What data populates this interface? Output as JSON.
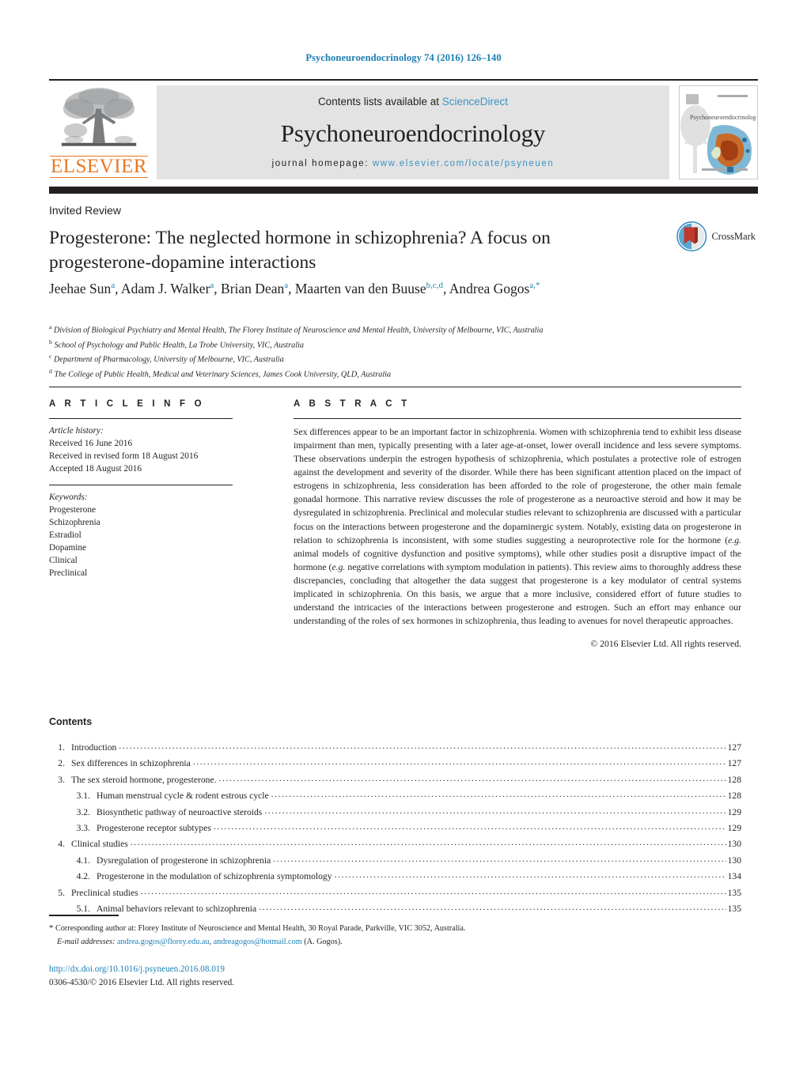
{
  "running_head": "Psychoneuroendocrinology 74 (2016) 126–140",
  "masthead": {
    "contents_prefix": "Contents lists available at ",
    "sciencedirect": "ScienceDirect",
    "journal_title": "Psychoneuroendocrinology",
    "homepage_prefix": "journal homepage: ",
    "homepage_url": "www.elsevier.com/locate/psyneuen",
    "publisher": "ELSEVIER",
    "cover_title": "Psychoneuroendocrinology",
    "accent_orange": "#e87722",
    "link_blue": "#3c93c2",
    "bar_black": "#231f20"
  },
  "article": {
    "type": "Invited Review",
    "title": "Progesterone: The neglected hormone in schizophrenia? A focus on progesterone-dopamine interactions",
    "crossmark_label": "CrossMark",
    "authors_html": "Jeehae Sun<sup>a</sup>, Adam J. Walker<sup>a</sup>, Brian Dean<sup>a</sup>, Maarten van den Buuse<sup>b,c,d</sup>, Andrea Gogos<sup>a,</sup><sup>*</sup>",
    "affiliations": [
      {
        "marker": "a",
        "text": "Division of Biological Psychiatry and Mental Health, The Florey Institute of Neuroscience and Mental Health, University of Melbourne, VIC, Australia"
      },
      {
        "marker": "b",
        "text": "School of Psychology and Public Health, La Trobe University, VIC, Australia"
      },
      {
        "marker": "c",
        "text": "Department of Pharmacology, University of Melbourne, VIC, Australia"
      },
      {
        "marker": "d",
        "text": "The College of Public Health, Medical and Veterinary Sciences, James Cook University, QLD, Australia"
      }
    ]
  },
  "info": {
    "heading": "A R T I C L E   I N F O",
    "history_label": "Article history:",
    "history": [
      "Received 16 June 2016",
      "Received in revised form 18 August 2016",
      "Accepted 18 August 2016"
    ],
    "keywords_label": "Keywords:",
    "keywords": [
      "Progesterone",
      "Schizophrenia",
      "Estradiol",
      "Dopamine",
      "Clinical",
      "Preclinical"
    ]
  },
  "abstract": {
    "heading": "A B S T R A C T",
    "body_html": "Sex differences appear to be an important factor in schizophrenia. Women with schizophrenia tend to exhibit less disease impairment than men, typically presenting with a later age-at-onset, lower overall incidence and less severe symptoms. These observations underpin the estrogen hypothesis of schizophrenia, which postulates a protective role of estrogen against the development and severity of the disorder. While there has been significant attention placed on the impact of estrogens in schizophrenia, less consideration has been afforded to the role of progesterone, the other main female gonadal hormone. This narrative review discusses the role of progesterone as a neuroactive steroid and how it may be dysregulated in schizophrenia. Preclinical and molecular studies relevant to schizophrenia are discussed with a particular focus on the interactions between progesterone and the dopaminergic system. Notably, existing data on progesterone in relation to schizophrenia is inconsistent, with some studies suggesting a neuroprotective role for the hormone (<em>e.g.</em> animal models of cognitive dysfunction and positive symptoms), while other studies posit a disruptive impact of the hormone (<em>e.g.</em> negative correlations with symptom modulation in patients). This review aims to thoroughly address these discrepancies, concluding that altogether the data suggest that progesterone is a key modulator of central systems implicated in schizophrenia. On this basis, we argue that a more inclusive, considered effort of future studies to understand the intricacies of the interactions between progesterone and estrogen. Such an effort may enhance our understanding of the roles of sex hormones in schizophrenia, thus leading to avenues for novel therapeutic approaches.",
    "copyright": "© 2016 Elsevier Ltd. All rights reserved."
  },
  "contents": {
    "heading": "Contents",
    "items": [
      {
        "level": 1,
        "num": "1.",
        "label": "Introduction",
        "page": "127"
      },
      {
        "level": 1,
        "num": "2.",
        "label": "Sex differences in schizophrenia",
        "page": "127"
      },
      {
        "level": 1,
        "num": "3.",
        "label": "The sex steroid hormone, progesterone.",
        "page": "128"
      },
      {
        "level": 2,
        "num": "3.1.",
        "label": "Human menstrual cycle & rodent estrous cycle",
        "page": "128"
      },
      {
        "level": 2,
        "num": "3.2.",
        "label": "Biosynthetic pathway of neuroactive steroids",
        "page": "129"
      },
      {
        "level": 2,
        "num": "3.3.",
        "label": "Progesterone receptor subtypes",
        "page": "129"
      },
      {
        "level": 1,
        "num": "4.",
        "label": "Clinical studies",
        "page": "130"
      },
      {
        "level": 2,
        "num": "4.1.",
        "label": "Dysregulation of progesterone in schizophrenia",
        "page": "130"
      },
      {
        "level": 2,
        "num": "4.2.",
        "label": "Progesterone in the modulation of schizophrenia symptomology",
        "page": "134"
      },
      {
        "level": 1,
        "num": "5.",
        "label": "Preclinical studies",
        "page": "135"
      },
      {
        "level": 2,
        "num": "5.1.",
        "label": "Animal behaviors relevant to schizophrenia",
        "page": "135"
      }
    ]
  },
  "footer": {
    "corresponding_marker": "*",
    "corresponding_text": "Corresponding author at: Florey Institute of Neuroscience and Mental Health, 30 Royal Parade, Parkville, VIC 3052, Australia.",
    "email_label": "E-mail addresses:",
    "email_1": "andrea.gogos@florey.edu.au",
    "email_2": "andreagogos@hotmail.com",
    "email_suffix": "(A. Gogos).",
    "doi": "http://dx.doi.org/10.1016/j.psyneuen.2016.08.019",
    "issn_line": "0306-4530/© 2016 Elsevier Ltd. All rights reserved."
  }
}
